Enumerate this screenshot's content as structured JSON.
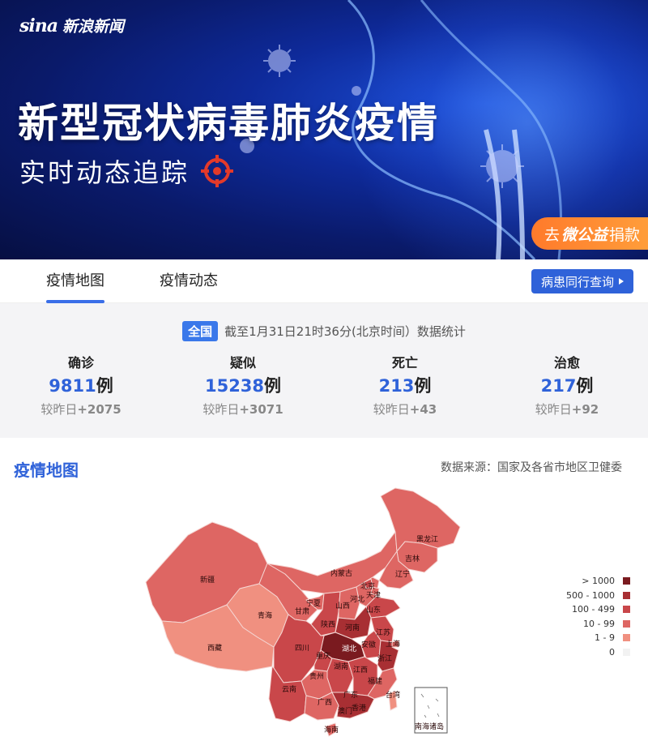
{
  "banner": {
    "brand_mark": "sina",
    "brand_name": "新浪新闻",
    "headline": "新型冠状病毒肺炎疫情",
    "subline": "实时动态追踪",
    "donate_prefix": "去",
    "donate_brand": "微公益",
    "donate_suffix": "捐款",
    "accent_color": "#ff8a33"
  },
  "tabs": [
    {
      "label": "疫情地图",
      "active": true
    },
    {
      "label": "疫情动态",
      "active": false
    }
  ],
  "track_button": "病患同行查询",
  "stats": {
    "scope": "全国",
    "timestamp": "截至1月31日21时36分(北京时间）数据统计",
    "items": [
      {
        "label": "确诊",
        "value": "9811",
        "unit": "例",
        "delta_label": "较昨日",
        "delta": "+2075"
      },
      {
        "label": "疑似",
        "value": "15238",
        "unit": "例",
        "delta_label": "较昨日",
        "delta": "+3071"
      },
      {
        "label": "死亡",
        "value": "213",
        "unit": "例",
        "delta_label": "较昨日",
        "delta": "+43"
      },
      {
        "label": "治愈",
        "value": "217",
        "unit": "例",
        "delta_label": "较昨日",
        "delta": "+92"
      }
    ]
  },
  "map": {
    "title": "疫情地图",
    "source": "数据来源：国家及各省市地区卫健委",
    "legend": [
      {
        "label": "> 1000",
        "color": "#7a1a1f"
      },
      {
        "label": "500 - 1000",
        "color": "#a82f33"
      },
      {
        "label": "100 - 499",
        "color": "#c9474a"
      },
      {
        "label": "10 - 99",
        "color": "#de6663"
      },
      {
        "label": "1 - 9",
        "color": "#f09080"
      },
      {
        "label": "0",
        "color": "#f2f2f2"
      }
    ],
    "provinces": {
      "heilongjiang": "黑龙江",
      "jilin": "吉林",
      "liaoning": "辽宁",
      "neimenggu": "内蒙古",
      "beijing": "北京",
      "tianjin": "天津",
      "hebei": "河北",
      "shanxi": "山西",
      "shandong": "山东",
      "xinjiang": "新疆",
      "qinghai": "青海",
      "gansu": "甘肃",
      "ningxia": "宁夏",
      "shaanxi": "陕西",
      "henan": "河南",
      "jiangsu": "江苏",
      "shanghai": "上海",
      "anhui": "安徽",
      "hubei": "湖北",
      "zhejiang": "浙江",
      "xizang": "西藏",
      "sichuan": "四川",
      "chongqing": "重庆",
      "hunan": "湖南",
      "jiangxi": "江西",
      "fujian": "福建",
      "guizhou": "贵州",
      "yunnan": "云南",
      "guangxi": "广西",
      "guangdong": "广东",
      "taiwan": "台湾",
      "aomen": "澳门",
      "xianggang": "香港",
      "hainan": "海南",
      "nanhai": "南海诸岛"
    }
  }
}
